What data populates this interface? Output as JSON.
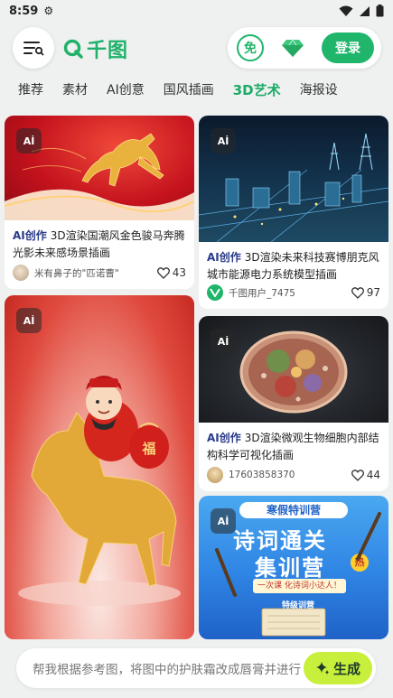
{
  "status_bar": {
    "time": "8:59"
  },
  "header": {
    "logo_text": "千图",
    "free_label": "免",
    "login_label": "登录"
  },
  "tabs": [
    {
      "label": "推荐"
    },
    {
      "label": "素材"
    },
    {
      "label": "AI创意"
    },
    {
      "label": "国风插画"
    },
    {
      "label": "3D艺术",
      "active": true
    },
    {
      "label": "海报设"
    }
  ],
  "cards": [
    {
      "badge": "Aİ",
      "tag": "AI创作",
      "title": "3D渲染国潮风金色骏马奔腾光影未来感场景插画",
      "author": "米有鼻子的\"匹诺曹\"",
      "likes": "43"
    },
    {
      "badge": "Aİ",
      "tag": "AI创作",
      "title": "3D渲染未来科技赛博朋克风城市能源电力系统模型插画",
      "author": "千图用户_7475",
      "likes": "97"
    },
    {
      "badge": "Aİ"
    },
    {
      "badge": "Aİ",
      "tag": "AI创作",
      "title": "3D渲染微观生物细胞内部结构科学可视化插画",
      "author": "17603858370",
      "likes": "44"
    },
    {
      "badge": "Aİ",
      "poster": {
        "line1": "寒假特训营",
        "line2": "诗词通关",
        "line3": "集训营",
        "hot": "热",
        "sub": "一次课 化诗词小达人！",
        "note": "特级训营"
      }
    }
  ],
  "bottom": {
    "prompt": "帮我根据参考图，将图中的护肤霜改成唇膏并进行",
    "generate_label": "生成"
  },
  "colors": {
    "brand_green": "#1fb56a",
    "ai_tag": "#2a3a8a",
    "generate_bg": "#c8ef3c"
  }
}
